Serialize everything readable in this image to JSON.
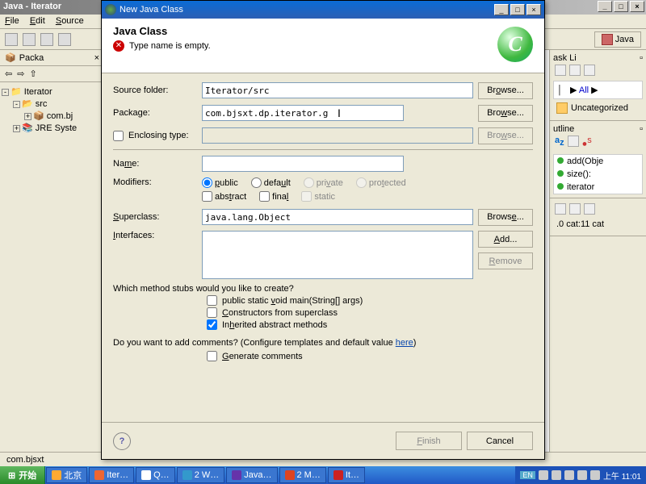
{
  "main": {
    "title": "Java - Iterator",
    "menu": {
      "file": "File",
      "edit": "Edit",
      "source": "Source"
    },
    "perspective": "Java"
  },
  "package_explorer": {
    "tab": "Packa",
    "project": "Iterator",
    "src": "src",
    "pkg": "com.bj",
    "jre": "JRE Syste"
  },
  "dialog": {
    "title": "New Java Class",
    "header": "Java Class",
    "error": "Type name is empty.",
    "labels": {
      "source_folder": "Source folder:",
      "package": "Package:",
      "enclosing": "Enclosing type:",
      "name": "Name:",
      "modifiers": "Modifiers:",
      "superclass": "Superclass:",
      "interfaces": "Interfaces:"
    },
    "values": {
      "source_folder": "Iterator/src",
      "package": "com.bjsxt.dp.iterator.g",
      "enclosing": "",
      "name": "",
      "superclass": "java.lang.Object"
    },
    "modifiers": {
      "public": "public",
      "default": "default",
      "private": "private",
      "protected": "protected",
      "abstract": "abstract",
      "final": "final",
      "static": "static"
    },
    "buttons": {
      "browse": "Browse...",
      "add": "Add...",
      "remove": "Remove",
      "finish": "Finish",
      "cancel": "Cancel"
    },
    "stubs": {
      "question": "Which method stubs would you like to create?",
      "main": "public static void main(String[] args)",
      "constructors": "Constructors from superclass",
      "inherited": "Inherited abstract methods"
    },
    "comments": {
      "question_pre": "Do you want to add comments? (Configure templates and default value ",
      "here": "here",
      "question_post": ")",
      "generate": "Generate comments"
    }
  },
  "right": {
    "tasklist": "ask Li",
    "all": "All",
    "uncategorized": "Uncategorized",
    "outline": "utline",
    "items": {
      "add": "add(Obje",
      "size": "size():",
      "iterator": "iterator"
    },
    "catline": ".0 cat:11 cat"
  },
  "status": {
    "path": "com.bjsxt"
  },
  "taskbar": {
    "start": "开始",
    "items": [
      "北京",
      "Iter…",
      "Q…",
      "2 W…",
      "Java…",
      "2 M…",
      "It…"
    ],
    "lang": "EN",
    "clock": "上午 11:01"
  }
}
